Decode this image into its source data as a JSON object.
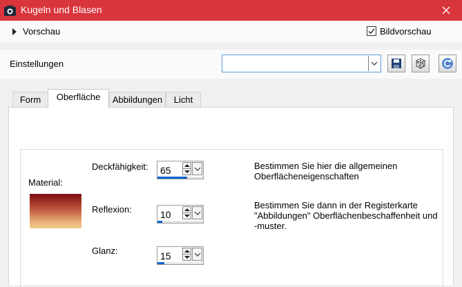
{
  "window": {
    "title": "Kugeln und Blasen"
  },
  "preview": {
    "label": "Vorschau",
    "checkbox_label": "Bildvorschau",
    "checked": true
  },
  "settings": {
    "label": "Einstellungen",
    "preset_value": ""
  },
  "tabs": [
    {
      "label": "Form",
      "active": false
    },
    {
      "label": "Oberfläche",
      "active": true
    },
    {
      "label": "Abbildungen",
      "active": false
    },
    {
      "label": "Licht",
      "active": false
    }
  ],
  "surface": {
    "material_label": "Material:",
    "fields": [
      {
        "label": "Deckfähigkeit:",
        "value": "65",
        "level": 0.65
      },
      {
        "label": "Reflexion:",
        "value": "10",
        "level": 0.1
      },
      {
        "label": "Glanz:",
        "value": "15",
        "level": 0.15
      }
    ],
    "help1": "Bestimmen Sie hier die allgemeinen Oberflächeneigenschaften",
    "help2": "Bestimmen Sie dann in der Registerkarte \"Abbildungen\" Oberflächenbeschaffenheit und -muster."
  },
  "colors": {
    "titlebar": "#d9353d",
    "accent": "#0a64d0",
    "material_top": "#7a0d10",
    "material_bottom": "#f3cd8d"
  }
}
